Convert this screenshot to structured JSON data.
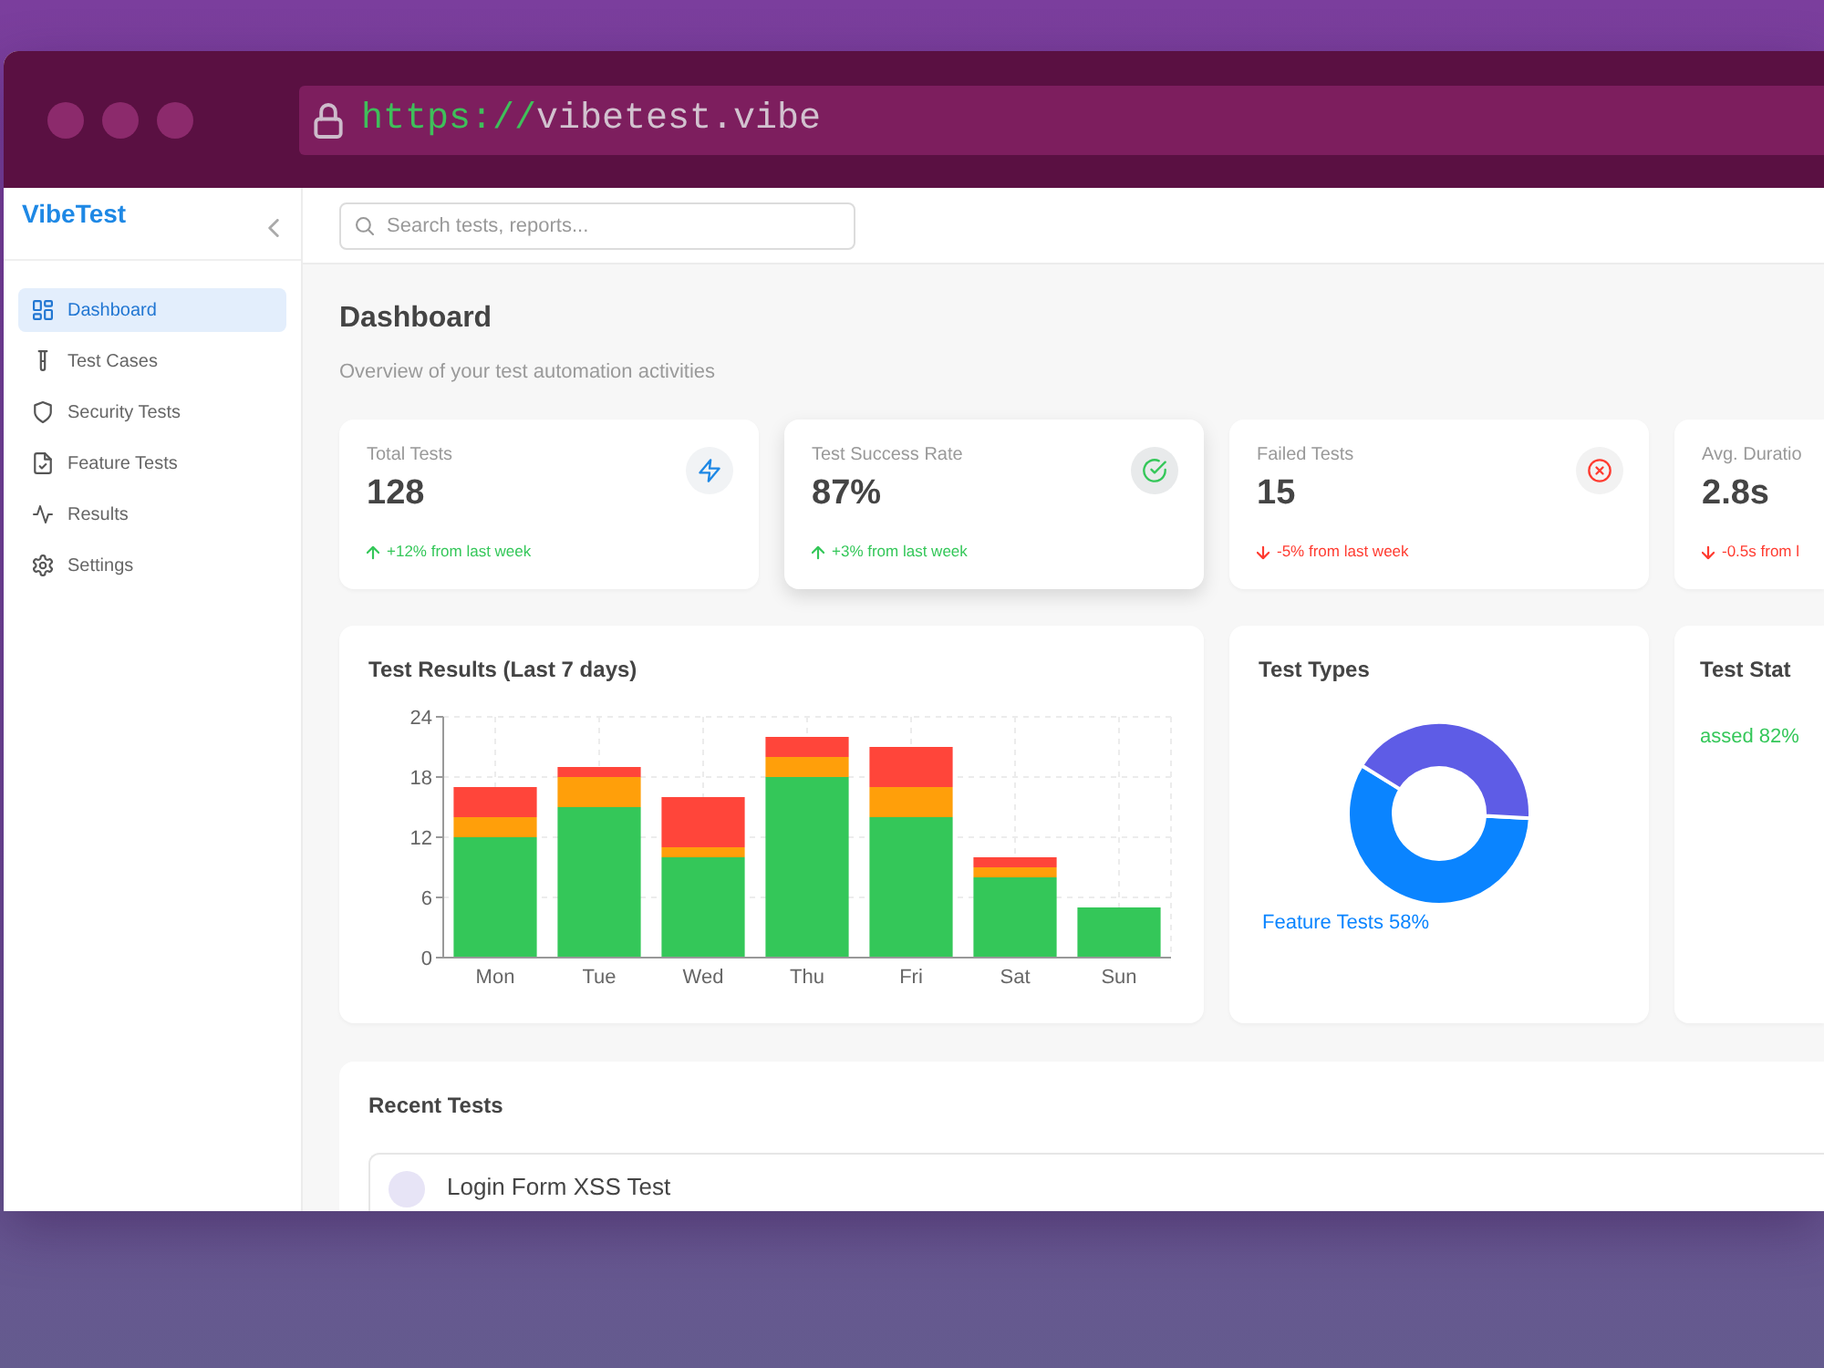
{
  "browser": {
    "url_scheme": "https://",
    "url_host": "vibetest.vibe"
  },
  "sidebar": {
    "brand": "VibeTest",
    "items": [
      {
        "label": "Dashboard",
        "selected": true
      },
      {
        "label": "Test Cases",
        "selected": false
      },
      {
        "label": "Security Tests",
        "selected": false
      },
      {
        "label": "Feature Tests",
        "selected": false
      },
      {
        "label": "Results",
        "selected": false
      },
      {
        "label": "Settings",
        "selected": false
      }
    ]
  },
  "search": {
    "placeholder": "Search tests, reports..."
  },
  "page": {
    "title": "Dashboard",
    "subtitle": "Overview of your test automation activities"
  },
  "stats": [
    {
      "label": "Total Tests",
      "value": "128",
      "change": "+12% from last week",
      "positive": true,
      "hovered": false
    },
    {
      "label": "Test Success Rate",
      "value": "87%",
      "change": "+3% from last week",
      "positive": true,
      "hovered": true
    },
    {
      "label": "Failed Tests",
      "value": "15",
      "change": "-5% from last week",
      "positive": false,
      "hovered": false
    },
    {
      "label": "Avg. Duratio",
      "value": "2.8s",
      "change": "-0.5s from l",
      "positive": false,
      "hovered": false
    }
  ],
  "results_chart": {
    "title": "Test Results (Last 7 days)",
    "chart_data": [
      {
        "type": "bar",
        "stacked": true,
        "categories": [
          "Mon",
          "Tue",
          "Wed",
          "Thu",
          "Fri",
          "Sat",
          "Sun"
        ],
        "series": [
          {
            "color": "#34c759",
            "values": [
              12,
              15,
              10,
              18,
              14,
              8,
              5
            ]
          },
          {
            "color": "#ff9f0a",
            "values": [
              2,
              3,
              1,
              2,
              3,
              1,
              0
            ]
          },
          {
            "color": "#ff453a",
            "values": [
              3,
              1,
              5,
              2,
              4,
              1,
              0
            ]
          }
        ],
        "ylim": [
          0,
          24
        ],
        "yticks": [
          0,
          6,
          12,
          18,
          24
        ],
        "grid": true
      }
    ]
  },
  "test_types": {
    "title": "Test Types",
    "chart_data": [
      {
        "type": "donut",
        "categories": [
          "Feature Tests",
          null
        ],
        "values": [
          58,
          42
        ],
        "colors": [
          "#0a84ff",
          "#5e5ce6"
        ],
        "value_labels": [
          "58%",
          null
        ]
      }
    ]
  },
  "test_status": {
    "title": "Test Stat",
    "label": "assed 82%"
  },
  "recent_tests": {
    "title": "Recent Tests",
    "items": [
      {
        "name": "Login Form XSS Test"
      }
    ]
  }
}
